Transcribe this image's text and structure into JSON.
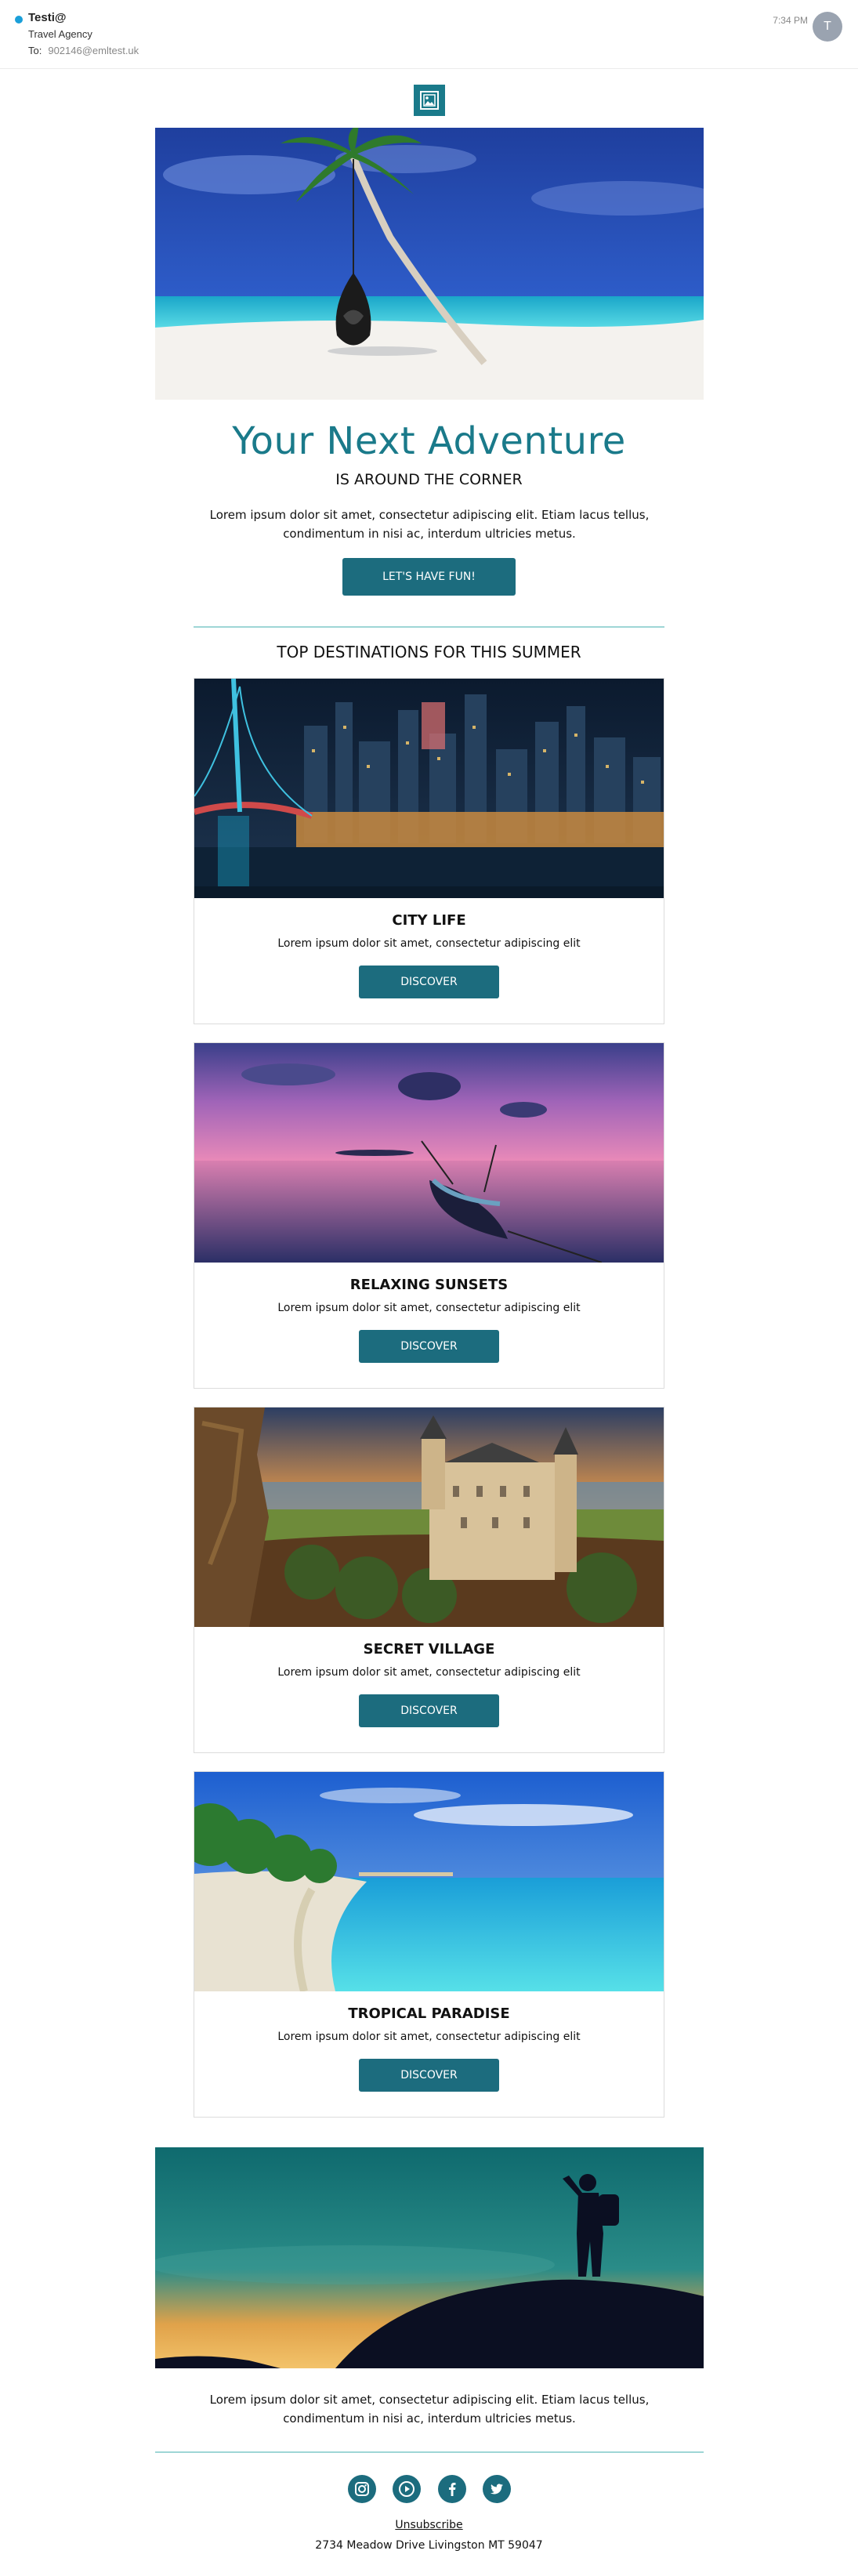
{
  "email": {
    "sender": "Testi@",
    "sender_name": "Travel Agency",
    "to_label": "To:",
    "to_address": "902146@emltest.uk",
    "time": "7:34 PM",
    "avatar_initial": "T"
  },
  "hero": {
    "headline": "Your Next Adventure",
    "subhead": "IS AROUND THE CORNER",
    "body": "Lorem ipsum dolor sit amet, consectetur adipiscing elit. Etiam lacus tellus, condimentum in nisi ac, interdum ultricies metus.",
    "cta_label": "LET'S HAVE FUN!"
  },
  "destinations": {
    "title": "TOP DESTINATIONS FOR THIS SUMMER",
    "cards": [
      {
        "title": "CITY LIFE",
        "text": "Lorem ipsum dolor sit amet, consectetur adipiscing elit",
        "button": "DISCOVER"
      },
      {
        "title": "RELAXING SUNSETS",
        "text": "Lorem ipsum dolor sit amet, consectetur adipiscing elit",
        "button": "DISCOVER"
      },
      {
        "title": "SECRET VILLAGE",
        "text": "Lorem ipsum dolor sit amet, consectetur adipiscing elit",
        "button": "DISCOVER"
      },
      {
        "title": "TROPICAL PARADISE",
        "text": "Lorem ipsum dolor sit amet, consectetur adipiscing elit",
        "button": "DISCOVER"
      }
    ]
  },
  "footer": {
    "body": "Lorem ipsum dolor sit amet, consectetur adipiscing elit. Etiam lacus tellus, condimentum in nisi ac, interdum ultricies metus.",
    "socials": [
      "instagram-icon",
      "youtube-icon",
      "facebook-icon",
      "twitter-icon"
    ],
    "unsubscribe": "Unsubscribe",
    "address": "2734 Meadow Drive Livingston MT 59047"
  },
  "colors": {
    "brand": "#1c6c7e",
    "headline": "#1a7a8a",
    "divider": "#9ed6d6",
    "unread": "#1a9fd9"
  }
}
